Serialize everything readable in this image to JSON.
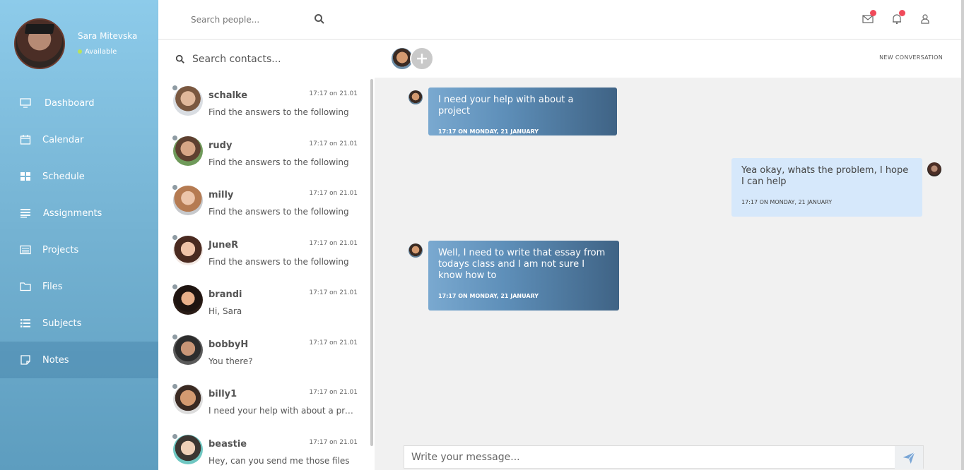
{
  "user": {
    "name": "Sara Mitevska",
    "status": "Available"
  },
  "nav": [
    {
      "label": "Dashboard",
      "icon": "monitor-icon"
    },
    {
      "label": "Calendar",
      "icon": "calendar-icon"
    },
    {
      "label": "Schedule",
      "icon": "grid-icon"
    },
    {
      "label": "Assignments",
      "icon": "list-icon"
    },
    {
      "label": "Projects",
      "icon": "projects-icon"
    },
    {
      "label": "Files",
      "icon": "folder-icon"
    },
    {
      "label": "Subjects",
      "icon": "bullets-icon"
    },
    {
      "label": "Notes",
      "icon": "note-icon",
      "active": true
    }
  ],
  "topbar": {
    "search_placeholder": "Search people..."
  },
  "contacts": {
    "search_placeholder": "Search contacts...",
    "items": [
      {
        "name": "schalke",
        "time": "17:17 on 21.01",
        "message": "Find the answers to the following"
      },
      {
        "name": "rudy",
        "time": "17:17 on 21.01",
        "message": "Find the answers to the following"
      },
      {
        "name": "milly",
        "time": "17:17 on 21.01",
        "message": "Find the answers to the following"
      },
      {
        "name": "JuneR",
        "time": "17:17 on 21.01",
        "message": "Find the answers to the following"
      },
      {
        "name": "brandi",
        "time": "17:17 on 21.01",
        "message": "Hi, Sara"
      },
      {
        "name": "bobbyH",
        "time": "17:17 on 21.01",
        "message": "You there?"
      },
      {
        "name": "billy1",
        "time": "17:17 on 21.01",
        "message": "I need your help with about a project"
      },
      {
        "name": "beastie",
        "time": "17:17 on 21.01",
        "message": "Hey, can you send me those files"
      }
    ]
  },
  "chat": {
    "new_conversation": "NEW CONVERSATION",
    "messages": [
      {
        "text": "I need your help with about a project",
        "time": "17:17 ON MONDAY, 21 JANUARY"
      },
      {
        "text": "Yea okay, whats the problem, I hope I can help",
        "time": "17:17 ON MONDAY, 21 JANUARY"
      },
      {
        "text": "Well, I need to write that essay from todays class and I am not sure I know how to",
        "time": "17:17 ON MONDAY, 21 JANUARY"
      }
    ],
    "compose_placeholder": "Write your message..."
  },
  "colors": {
    "accent": "#f04a5a",
    "sidebar_top": "#8dcbea",
    "sidebar_bottom": "#5d9dbf",
    "bubble_in": "#4a7099",
    "bubble_out": "#d6e8fb"
  }
}
